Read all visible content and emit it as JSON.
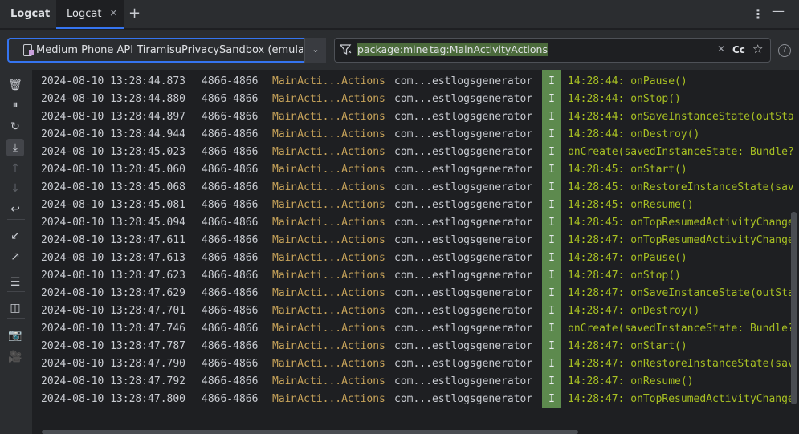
{
  "header": {
    "tool_title": "Logcat",
    "tab_label": "Logcat",
    "tab_close": "×",
    "add_tab": "+",
    "more": "⋮",
    "minimize": "—"
  },
  "toolbar": {
    "device_label": "Medium Phone API TiramisuPrivacySandbox (emulato",
    "filter_chips": [
      "package:mine",
      "tag:MainActivityActions"
    ],
    "clear_label": "✕",
    "case_label": "Cc",
    "favorite_label": "☆",
    "help_label": "?"
  },
  "sidebar": {
    "items": [
      {
        "name": "clear-logcat-icon",
        "glyph": "🗑"
      },
      {
        "name": "pause-icon",
        "glyph": "⏸"
      },
      {
        "name": "restart-icon",
        "glyph": "↻"
      },
      {
        "name": "scroll-to-end-icon",
        "glyph": "⤓"
      },
      {
        "name": "previous-occurrence-icon",
        "glyph": "↑"
      },
      {
        "name": "next-occurrence-icon",
        "glyph": "↓"
      },
      {
        "name": "soft-wrap-icon",
        "glyph": "↩"
      },
      {
        "name": "import-icon",
        "glyph": "↙"
      },
      {
        "name": "export-icon",
        "glyph": "↗"
      },
      {
        "name": "format-settings-icon",
        "glyph": "☰"
      },
      {
        "name": "split-panels-icon",
        "glyph": "◫"
      },
      {
        "name": "screenshot-icon",
        "glyph": "📷"
      },
      {
        "name": "screen-record-icon",
        "glyph": "🎥"
      }
    ]
  },
  "log": {
    "rows": [
      {
        "time": "2024-08-10 13:28:44.873",
        "pid": "4866-4866",
        "tag": "MainActi...Actions",
        "pkg": "com...estlogsgenerator",
        "level": "I",
        "msg": "14:28:44: onPause()"
      },
      {
        "time": "2024-08-10 13:28:44.880",
        "pid": "4866-4866",
        "tag": "MainActi...Actions",
        "pkg": "com...estlogsgenerator",
        "level": "I",
        "msg": "14:28:44: onStop()"
      },
      {
        "time": "2024-08-10 13:28:44.897",
        "pid": "4866-4866",
        "tag": "MainActi...Actions",
        "pkg": "com...estlogsgenerator",
        "level": "I",
        "msg": "14:28:44: onSaveInstanceState(outSta"
      },
      {
        "time": "2024-08-10 13:28:44.944",
        "pid": "4866-4866",
        "tag": "MainActi...Actions",
        "pkg": "com...estlogsgenerator",
        "level": "I",
        "msg": "14:28:44: onDestroy()"
      },
      {
        "time": "2024-08-10 13:28:45.023",
        "pid": "4866-4866",
        "tag": "MainActi...Actions",
        "pkg": "com...estlogsgenerator",
        "level": "I",
        "msg": "onCreate(savedInstanceState: Bundle?"
      },
      {
        "time": "2024-08-10 13:28:45.060",
        "pid": "4866-4866",
        "tag": "MainActi...Actions",
        "pkg": "com...estlogsgenerator",
        "level": "I",
        "msg": "14:28:45: onStart()"
      },
      {
        "time": "2024-08-10 13:28:45.068",
        "pid": "4866-4866",
        "tag": "MainActi...Actions",
        "pkg": "com...estlogsgenerator",
        "level": "I",
        "msg": "14:28:45: onRestoreInstanceState(sav"
      },
      {
        "time": "2024-08-10 13:28:45.081",
        "pid": "4866-4866",
        "tag": "MainActi...Actions",
        "pkg": "com...estlogsgenerator",
        "level": "I",
        "msg": "14:28:45: onResume()"
      },
      {
        "time": "2024-08-10 13:28:45.094",
        "pid": "4866-4866",
        "tag": "MainActi...Actions",
        "pkg": "com...estlogsgenerator",
        "level": "I",
        "msg": "14:28:45: onTopResumedActivityChange"
      },
      {
        "time": "2024-08-10 13:28:47.611",
        "pid": "4866-4866",
        "tag": "MainActi...Actions",
        "pkg": "com...estlogsgenerator",
        "level": "I",
        "msg": "14:28:47: onTopResumedActivityChange"
      },
      {
        "time": "2024-08-10 13:28:47.613",
        "pid": "4866-4866",
        "tag": "MainActi...Actions",
        "pkg": "com...estlogsgenerator",
        "level": "I",
        "msg": "14:28:47: onPause()"
      },
      {
        "time": "2024-08-10 13:28:47.623",
        "pid": "4866-4866",
        "tag": "MainActi...Actions",
        "pkg": "com...estlogsgenerator",
        "level": "I",
        "msg": "14:28:47: onStop()"
      },
      {
        "time": "2024-08-10 13:28:47.629",
        "pid": "4866-4866",
        "tag": "MainActi...Actions",
        "pkg": "com...estlogsgenerator",
        "level": "I",
        "msg": "14:28:47: onSaveInstanceState(outSta"
      },
      {
        "time": "2024-08-10 13:28:47.701",
        "pid": "4866-4866",
        "tag": "MainActi...Actions",
        "pkg": "com...estlogsgenerator",
        "level": "I",
        "msg": "14:28:47: onDestroy()"
      },
      {
        "time": "2024-08-10 13:28:47.746",
        "pid": "4866-4866",
        "tag": "MainActi...Actions",
        "pkg": "com...estlogsgenerator",
        "level": "I",
        "msg": "onCreate(savedInstanceState: Bundle?"
      },
      {
        "time": "2024-08-10 13:28:47.787",
        "pid": "4866-4866",
        "tag": "MainActi...Actions",
        "pkg": "com...estlogsgenerator",
        "level": "I",
        "msg": "14:28:47: onStart()"
      },
      {
        "time": "2024-08-10 13:28:47.790",
        "pid": "4866-4866",
        "tag": "MainActi...Actions",
        "pkg": "com...estlogsgenerator",
        "level": "I",
        "msg": "14:28:47: onRestoreInstanceState(sav"
      },
      {
        "time": "2024-08-10 13:28:47.792",
        "pid": "4866-4866",
        "tag": "MainActi...Actions",
        "pkg": "com...estlogsgenerator",
        "level": "I",
        "msg": "14:28:47: onResume()"
      },
      {
        "time": "2024-08-10 13:28:47.800",
        "pid": "4866-4866",
        "tag": "MainActi...Actions",
        "pkg": "com...estlogsgenerator",
        "level": "I",
        "msg": "14:28:47: onTopResumedActivityChange"
      }
    ]
  },
  "colors": {
    "accent": "#3574f0",
    "info_level": "#5d8a4e",
    "tag": "#c7a35a",
    "message": "#a8c023"
  }
}
